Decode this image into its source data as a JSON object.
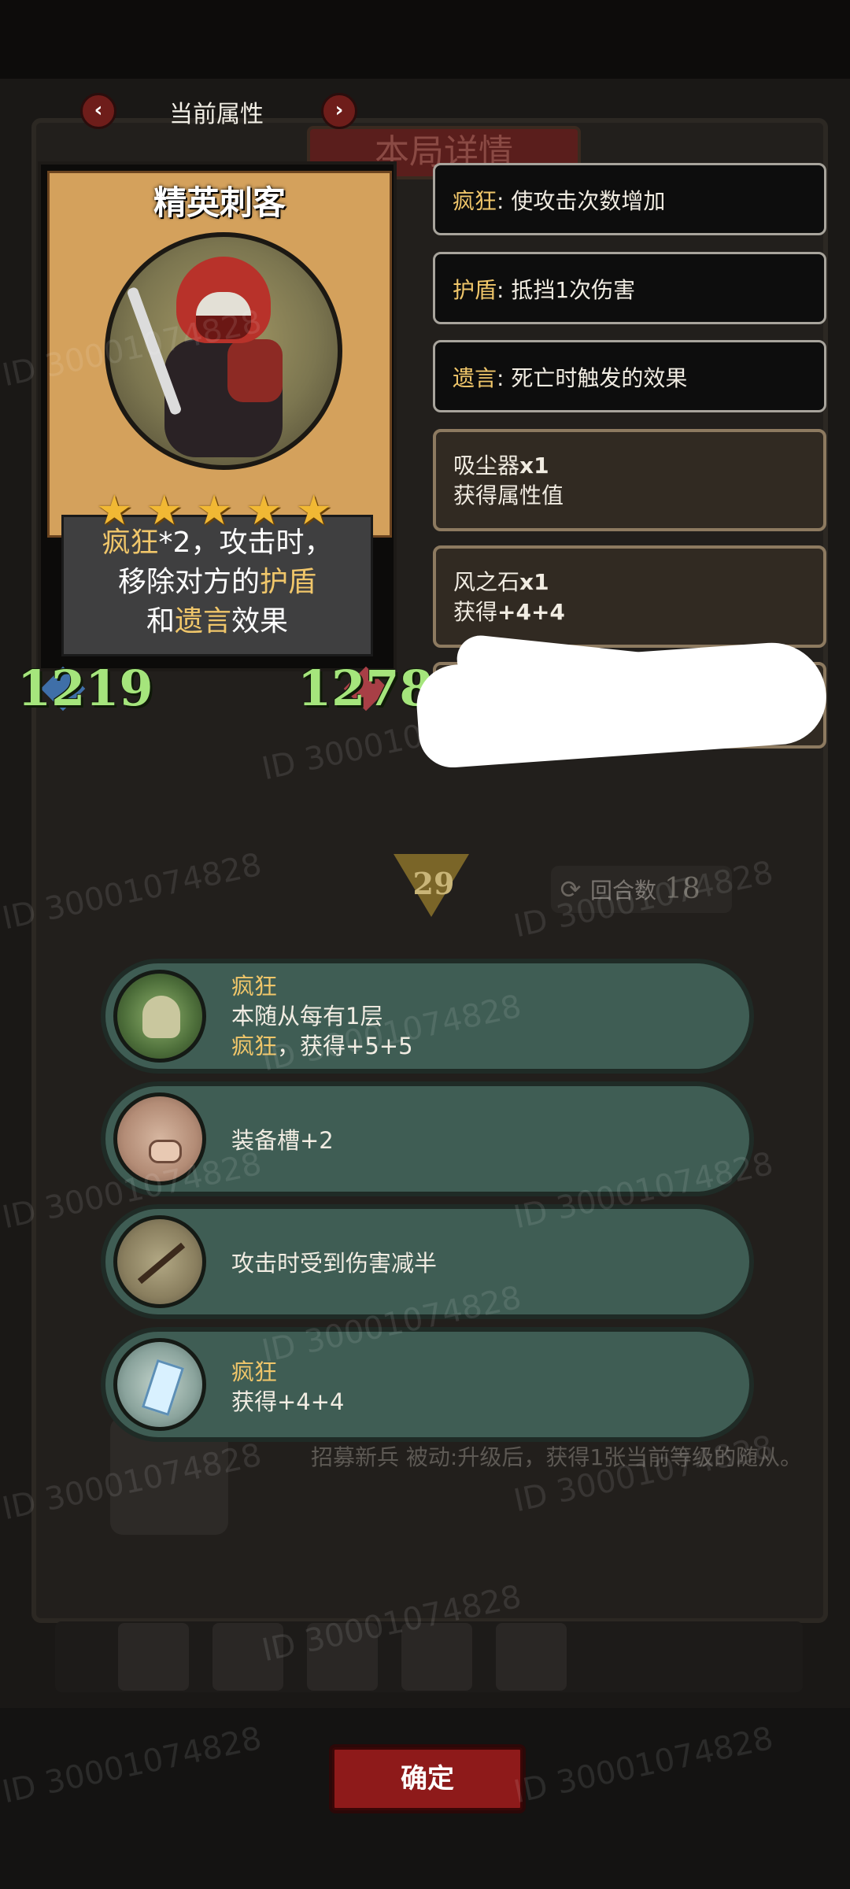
{
  "header": {
    "title": "当前属性"
  },
  "background_title": "本局详情",
  "card": {
    "name": "精英刺客",
    "stars": 5,
    "desc": {
      "line1_kw": "疯狂",
      "line1_rest": "*2，攻击时，",
      "line2_pre": "移除对方的",
      "line2_kw": "护盾",
      "line3_pre": "和",
      "line3_kw": "遗言",
      "line3_post": "效果"
    },
    "attack": "1219",
    "health": "1278"
  },
  "keywords": [
    {
      "kw": "疯狂",
      "desc": ": 使攻击次数增加"
    },
    {
      "kw": "护盾",
      "desc": ": 抵挡1次伤害"
    },
    {
      "kw": "遗言",
      "desc": ": 死亡时触发的效果"
    }
  ],
  "items": [
    {
      "name": "吸尘器",
      "count": "x1",
      "effect": "获得属性值"
    },
    {
      "name": "风之石",
      "count": "x1",
      "effect_pre": "获得",
      "effect_val": "+4+4"
    }
  ],
  "middle": {
    "gem_value": "29",
    "round_label": "回合数",
    "round_value": "18"
  },
  "effects": [
    {
      "icon": "skull-icon",
      "title": "疯狂",
      "line2": "本随从每有1层",
      "line3_kw": "疯狂",
      "line3_rest": "，获得+5+5"
    },
    {
      "icon": "pig-icon",
      "text": "装备槽+2"
    },
    {
      "icon": "arrow-icon",
      "text": "攻击时受到伤害减半"
    },
    {
      "icon": "crystal-icon",
      "title": "疯狂",
      "line2": "获得+4+4"
    }
  ],
  "background_row": {
    "text": "招募新兵 被动:升级后，获得1张当前等级的随从。"
  },
  "confirm_label": "确定",
  "watermark": "ID 30001074828",
  "colors": {
    "keyword_gold": "#f0c66a",
    "stat_green": "#a5e57c",
    "effect_bg": "#3f5d54",
    "confirm_red": "#8e1a1a"
  }
}
